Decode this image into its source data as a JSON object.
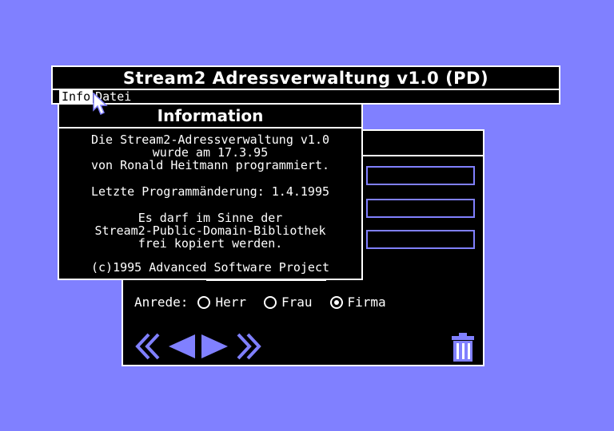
{
  "app": {
    "title": "Stream2 Adressverwaltung v1.0 (PD)"
  },
  "menu": {
    "items": [
      {
        "label": "Info",
        "active": true
      },
      {
        "label": "Datei",
        "active": false
      }
    ]
  },
  "info_dialog": {
    "title": "Information",
    "lines": [
      "Die Stream2-Adressverwaltung v1.0",
      "wurde am 17.3.95",
      "von Ronald Heitmann programmiert.",
      "Letzte Programmänderung: 1.4.1995",
      "Es darf im Sinne der",
      "Stream2-Public-Domain-Bibliothek",
      "frei kopiert werden.",
      "(c)1995 Advanced Software Project"
    ]
  },
  "form": {
    "anrede_label": "Anrede:",
    "anrede_options": [
      {
        "label": "Herr",
        "checked": false
      },
      {
        "label": "Frau",
        "checked": false
      },
      {
        "label": "Firma",
        "checked": true
      }
    ]
  },
  "navigation": {
    "icons": [
      "first-record-icon",
      "previous-record-icon",
      "next-record-icon",
      "last-record-icon"
    ]
  },
  "colors": {
    "background": "#8080ff",
    "panel": "#000000",
    "foreground": "#ffffff",
    "accent": "#8080ff"
  }
}
